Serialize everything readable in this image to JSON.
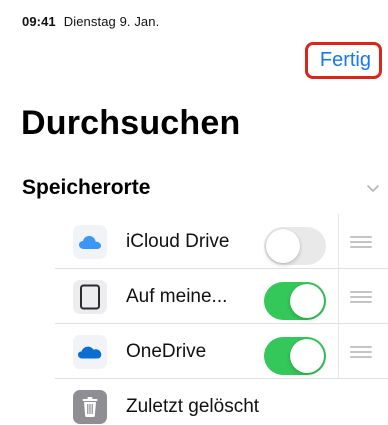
{
  "status": {
    "time": "09:41",
    "date": "Dienstag 9. Jan."
  },
  "header": {
    "done_label": "Fertig",
    "title": "Durchsuchen"
  },
  "section": {
    "title": "Speicherorte"
  },
  "locations": [
    {
      "label": "iCloud Drive",
      "icon": "icloud-icon",
      "toggle": false,
      "color": "#3a97f5"
    },
    {
      "label": "Auf meine...",
      "icon": "ipad-icon",
      "toggle": true,
      "color": "#2c2c2e"
    },
    {
      "label": "OneDrive",
      "icon": "onedrive-icon",
      "toggle": true,
      "color": "#0a6ed1"
    },
    {
      "label": "Zuletzt gelöscht",
      "icon": "trash-icon",
      "color": "#8e8e93"
    }
  ],
  "colors": {
    "accent": "#1877f2",
    "toggle_on": "#34c759",
    "highlight": "#d9261c"
  }
}
